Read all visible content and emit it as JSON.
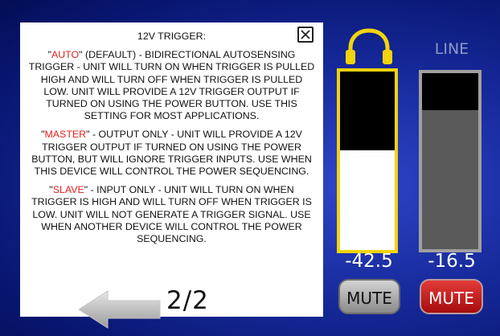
{
  "help_panel": {
    "title": "12V TRIGGER:",
    "paragraphs": [
      {
        "mode": "AUTO",
        "text": " (DEFAULT) - BIDIRECTIONAL AUTOSENSING TRIGGER - UNIT WILL TURN ON WHEN TRIGGER IS PULLED HIGH AND WILL TURN OFF WHEN TRIGGER IS PULLED LOW. UNIT WILL PROVIDE A 12V TRIGGER OUTPUT IF TURNED ON USING THE POWER BUTTON. USE THIS SETTING FOR MOST APPLICATIONS."
      },
      {
        "mode": "MASTER",
        "text": " - OUTPUT ONLY - UNIT WILL PROVIDE A 12V TRIGGER OUTPUT IF TURNED ON USING THE POWER BUTTON, BUT WILL IGNORE TRIGGER INPUTS. USE WHEN THIS DEVICE WILL CONTROL THE POWER SEQUENCING."
      },
      {
        "mode": "SLAVE",
        "text": " - INPUT ONLY - UNIT WILL TURN ON WHEN TRIGGER IS HIGH AND WILL TURN OFF WHEN TRIGGER IS LOW. UNIT WILL NOT GENERATE A TRIGGER SIGNAL. USE WHEN ANOTHER DEVICE WILL CONTROL THE POWER SEQUENCING."
      }
    ],
    "close_icon": "close-x-icon",
    "back_icon": "left-arrow-icon",
    "page_indicator": "2/2"
  },
  "headphone": {
    "icon": "headphones-icon",
    "level": "-42.5",
    "meter_fill": 0.56,
    "mute_label": "MUTE",
    "muted": false
  },
  "line": {
    "label": "LINE",
    "level": "-16.5",
    "meter_fill": 0.79,
    "mute_label": "MUTE",
    "muted": true
  },
  "colors": {
    "highlight": "#e0211d",
    "headphone_accent": "#f2d30c",
    "mute_active": "#c81a1a",
    "background": "#14289a"
  }
}
